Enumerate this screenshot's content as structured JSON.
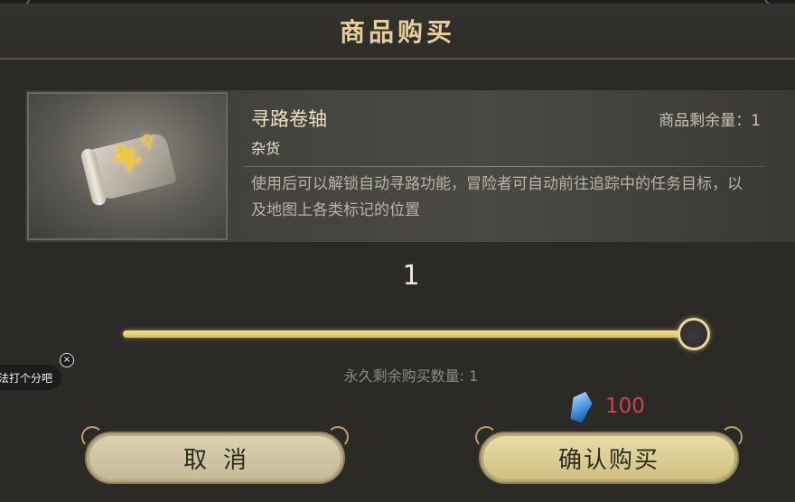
{
  "dialog": {
    "title": "商品购买"
  },
  "item": {
    "name": "寻路卷轴",
    "category": "杂货",
    "stock_text": "商品剩余量：1",
    "description": "使用后可以解锁自动寻路功能，冒险者可自动前往追踪中的任务目标，以及地图上各类标记的位置",
    "icon": "scroll-map-icon"
  },
  "purchase": {
    "quantity": "1",
    "slider_value": 1,
    "slider_max": 1,
    "permanent_limit_text": "永久剩余购买数量: 1",
    "price": "100",
    "currency_icon": "blue-crystal-icon"
  },
  "buttons": {
    "cancel": "取消",
    "confirm": "确认购买"
  },
  "overlay": {
    "rate_text": "法打个分吧",
    "close_glyph": "×"
  },
  "colors": {
    "title": "#e6cf9a",
    "slider_fill": "#e3cb6e",
    "price": "#c8454b",
    "button_fill": "#d8cca0"
  }
}
